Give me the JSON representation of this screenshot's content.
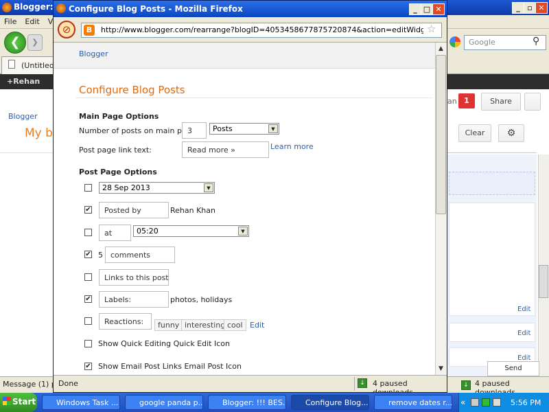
{
  "background_window": {
    "title": "Blogger: !!!",
    "menu": [
      "File",
      "Edit",
      "V"
    ],
    "search_placeholder": "Google",
    "tab_label": "(Untitled)",
    "gbar_user": "+Rehan",
    "gbar_more": "S",
    "blogger_link": "Blogger",
    "blog_title": "My bl",
    "partial_text": "an",
    "notification_count": "1",
    "share_label": "Share",
    "clear_label": "Clear",
    "edit_labels": [
      "Edit",
      "Edit",
      "Edit"
    ],
    "status_message": "Message (1) p",
    "downloads": "4 paused downloads",
    "send_feedback": "Send feedback"
  },
  "popup": {
    "title": "Configure Blog Posts - Mozilla Firefox",
    "url": "http://www.blogger.com/rearrange?blogID=4053458677875720874&action=editWidget&sectionI",
    "header_link": "Blogger",
    "page_title": "Configure Blog Posts",
    "status": "Done",
    "downloads": "4 paused downloads"
  },
  "main_options": {
    "heading": "Main Page Options",
    "num_posts_label": "Number of posts on main page:",
    "num_posts_value": "3",
    "num_posts_unit": "Posts",
    "link_text_label": "Post page link text:",
    "link_text_value": "Read more »",
    "learn_more": "Learn more"
  },
  "post_options": {
    "heading": "Post Page Options",
    "date_value": "28 Sep 2013",
    "posted_by_label": "Posted by",
    "author": "Rehan Khan",
    "at_label": "at",
    "time_value": "05:20",
    "comments_count": "5",
    "comments_label": "comments",
    "links_label": "Links to this post",
    "labels_label": "Labels:",
    "labels_value": "photos, holidays",
    "reactions_label": "Reactions:",
    "reactions": [
      "funny",
      "interesting",
      "cool"
    ],
    "reactions_edit": "Edit",
    "quick_edit": "Show Quick Editing Quick Edit Icon",
    "email_links": "Show Email Post Links Email Post Icon",
    "checked": [
      false,
      true,
      false,
      true,
      false,
      true,
      false,
      false,
      true
    ]
  },
  "taskbar": {
    "start": "Start",
    "tasks": [
      "Windows Task ...",
      "google panda p...",
      "Blogger: !!! BES...",
      "Configure Blog...",
      "remove dates r..."
    ],
    "clock": "5:56 PM",
    "tray_chevron": "«"
  }
}
